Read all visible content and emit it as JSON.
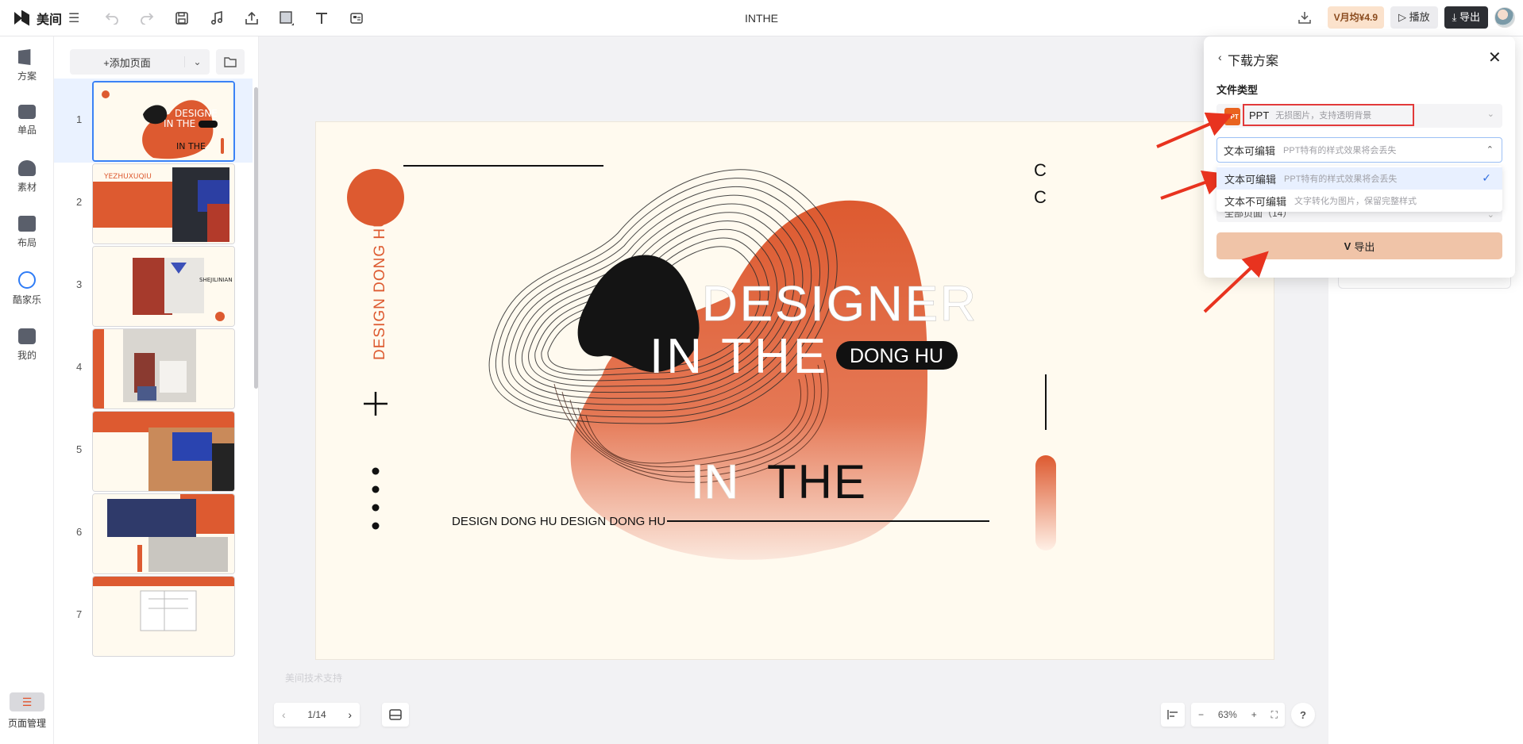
{
  "app": {
    "logo_text": "美间",
    "menu_glyph": "☰",
    "doc_title": "INTHE"
  },
  "toolbar": {
    "vip_label": "V月均¥4.9",
    "play_label": "▷ 播放",
    "export_label": "⤓ 导出"
  },
  "rail": {
    "items": [
      {
        "label": "方案",
        "icon": "plan-icon"
      },
      {
        "label": "单品",
        "icon": "single-product-icon"
      },
      {
        "label": "素材",
        "icon": "material-icon"
      },
      {
        "label": "布局",
        "icon": "layout-icon"
      },
      {
        "label": "酷家乐",
        "icon": "kujiale-icon"
      },
      {
        "label": "我的",
        "icon": "profile-icon"
      }
    ],
    "page_manager": "页面管理"
  },
  "pages_panel": {
    "add_page": "+添加页面",
    "thumb_numbers": [
      "1",
      "2",
      "3",
      "4",
      "5",
      "6",
      "7"
    ],
    "selected_index": 0
  },
  "slide": {
    "vertical_text": "DESIGN DONG HU",
    "line1": "DESIGNER",
    "line2": "IN THE",
    "pill": "DONG HU",
    "line3_a": "IN",
    "line3_b": "THE",
    "bottom_text": "DESIGN DONG HU DESIGN DONG HU",
    "accent_color": "#dd5a30",
    "bg_color": "#fffaef"
  },
  "canvas": {
    "watermark": "美间技术支持",
    "pager": "1/14",
    "zoom": "63%",
    "zoom_minus": "−",
    "zoom_plus": "+",
    "help": "?"
  },
  "download": {
    "title": "下载方案",
    "file_type_label": "文件类型",
    "ppt_icon_text": "PPT",
    "ppt_name": "PPT",
    "ppt_desc": "无损图片，支持透明背景",
    "edit_selected_name": "文本可编辑",
    "edit_selected_desc": "PPT特有的样式效果将会丢失",
    "options": [
      {
        "name": "文本可编辑",
        "desc": "PPT特有的样式效果将会丢失",
        "selected": true
      },
      {
        "name": "文本不可编辑",
        "desc": "文字转化为图片，保留完整样式",
        "selected": false
      }
    ],
    "pages_value": "全部页面（14）",
    "export_label": "导出",
    "export_v": "V"
  }
}
